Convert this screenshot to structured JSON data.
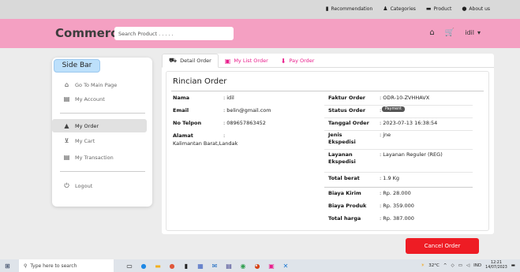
{
  "topnav": [
    {
      "icon": "chart-icon",
      "glyph": "▮",
      "label": "Recommendation"
    },
    {
      "icon": "categories-icon",
      "glyph": "♟",
      "label": "Categories"
    },
    {
      "icon": "product-icon",
      "glyph": "▬",
      "label": "Product"
    },
    {
      "icon": "info-icon",
      "glyph": "●",
      "label": "About us"
    }
  ],
  "header": {
    "brand": "Commerce",
    "search_placeholder": "Search Product . . . . .",
    "user": "idil"
  },
  "sidebar": {
    "title": "Side Bar",
    "items": [
      {
        "label": "Go To Main Page",
        "icon": "home-icon"
      },
      {
        "label": "My Account",
        "icon": "account-icon"
      },
      {
        "label": "My Order",
        "icon": "order-icon",
        "active": true
      },
      {
        "label": "My Cart",
        "icon": "cart-icon"
      },
      {
        "label": "My Transaction",
        "icon": "transaction-icon"
      },
      {
        "label": "Logout",
        "icon": "power-icon"
      }
    ]
  },
  "tabs": [
    {
      "label": "Detail Order",
      "icon": "truck-icon",
      "active": true
    },
    {
      "label": "My List Order",
      "icon": "list-icon"
    },
    {
      "label": "Pay Order",
      "icon": "pay-icon"
    }
  ],
  "order": {
    "title": "Rincian Order",
    "customer": [
      {
        "label": "Nama",
        "value": ": idil"
      },
      {
        "label": "Email",
        "value": ": belin@gmail.com"
      },
      {
        "label": "No Telpon",
        "value": ": 089657863452"
      },
      {
        "label": "Alamat",
        "value": ":"
      }
    ],
    "address": "Kalimantan Barat,Landak",
    "details": [
      {
        "label": "Faktur Order",
        "value": ": ODR-10-ZVHHAVX"
      },
      {
        "label": "Status Order",
        "value": ":"
      },
      {
        "label": "Tanggal Order",
        "value": ": 2023-07-13 16:38:54"
      },
      {
        "label": "Jenis Ekspedisi",
        "value": ": jne"
      },
      {
        "label": "Layanan Ekspedisi",
        "value": ": Layanan Reguler (REG)"
      },
      {
        "label": "Total berat",
        "value": ": 1.9 Kg"
      }
    ],
    "status_badge": "Payment",
    "summary": [
      {
        "label": "Biaya Kirim",
        "value": ": Rp. 28.000"
      },
      {
        "label": "Biaya Produk",
        "value": ": Rp. 359.000"
      },
      {
        "label": "Total harga",
        "value": ": Rp. 387.000"
      }
    ]
  },
  "cancel_button": "Cancel Order",
  "taskbar": {
    "search_placeholder": "Type here to search",
    "weather": "32°C",
    "lang": "IND",
    "time": "12:21",
    "date": "14/07/2023"
  },
  "colors": {
    "header": "#f4a0c2",
    "accent": "#e91e8c",
    "danger": "#ee1c24",
    "sidebar_title": "#bde0fb"
  }
}
